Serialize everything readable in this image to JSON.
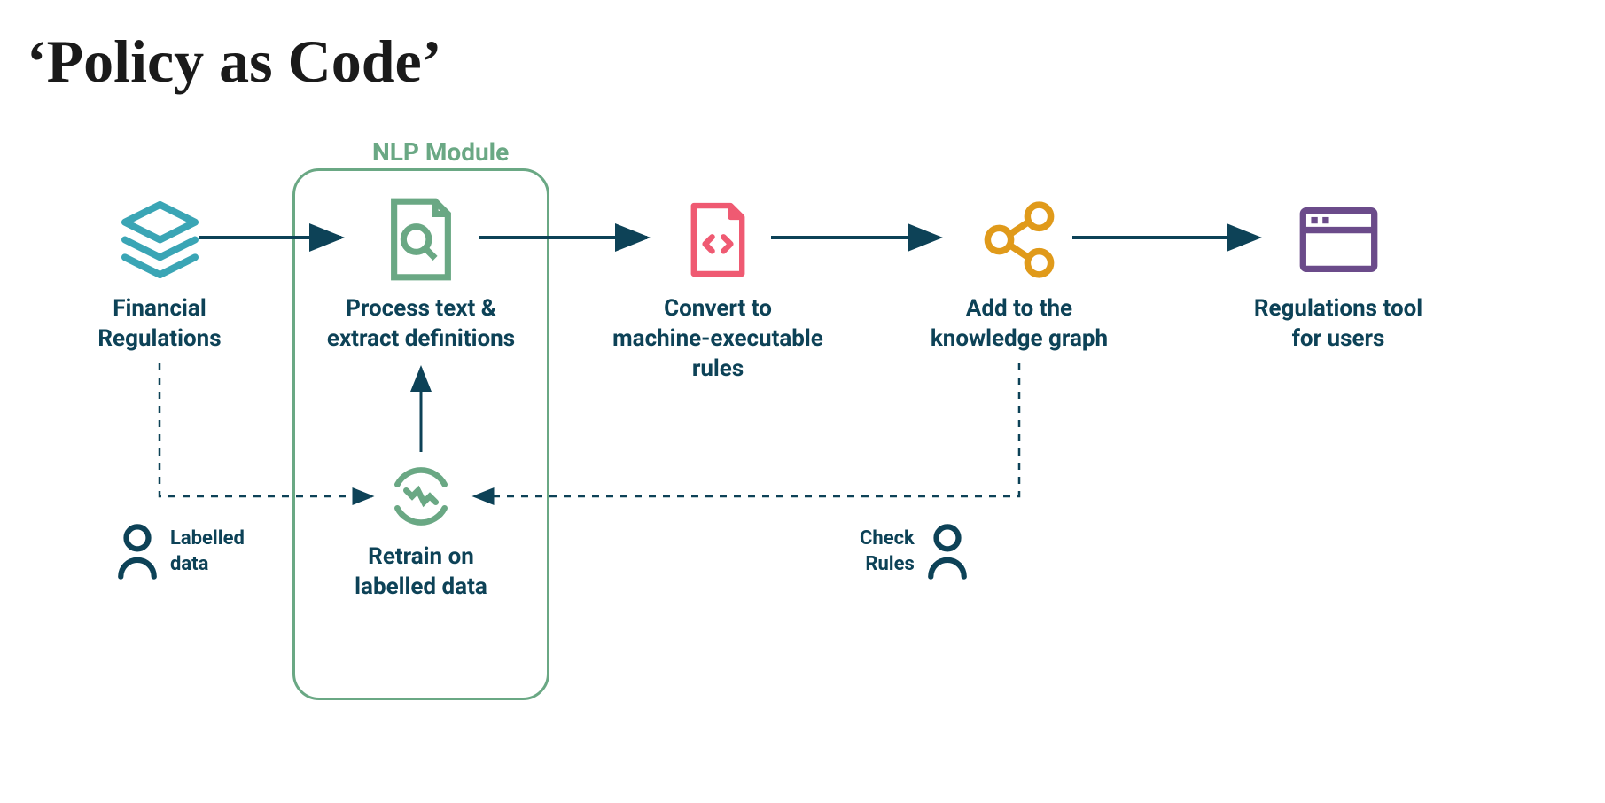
{
  "title": "‘Policy as Code’",
  "module_label": "NLP Module",
  "nodes": {
    "financial": "Financial\nRegulations",
    "process": "Process text &\nextract definitions",
    "retrain": "Retrain on\nlabelled data",
    "convert": "Convert to\nmachine-executable\nrules",
    "graph": "Add to the\nknowledge graph",
    "tool": "Regulations tool\nfor users"
  },
  "annotations": {
    "labelled_data": "Labelled\ndata",
    "check_rules": "Check\nRules"
  },
  "colors": {
    "teal": "#3aa5b5",
    "green": "#6aa884",
    "pink": "#ef5a72",
    "orange": "#e09a1a",
    "purple": "#6b4b8a",
    "dark": "#0d4257"
  }
}
